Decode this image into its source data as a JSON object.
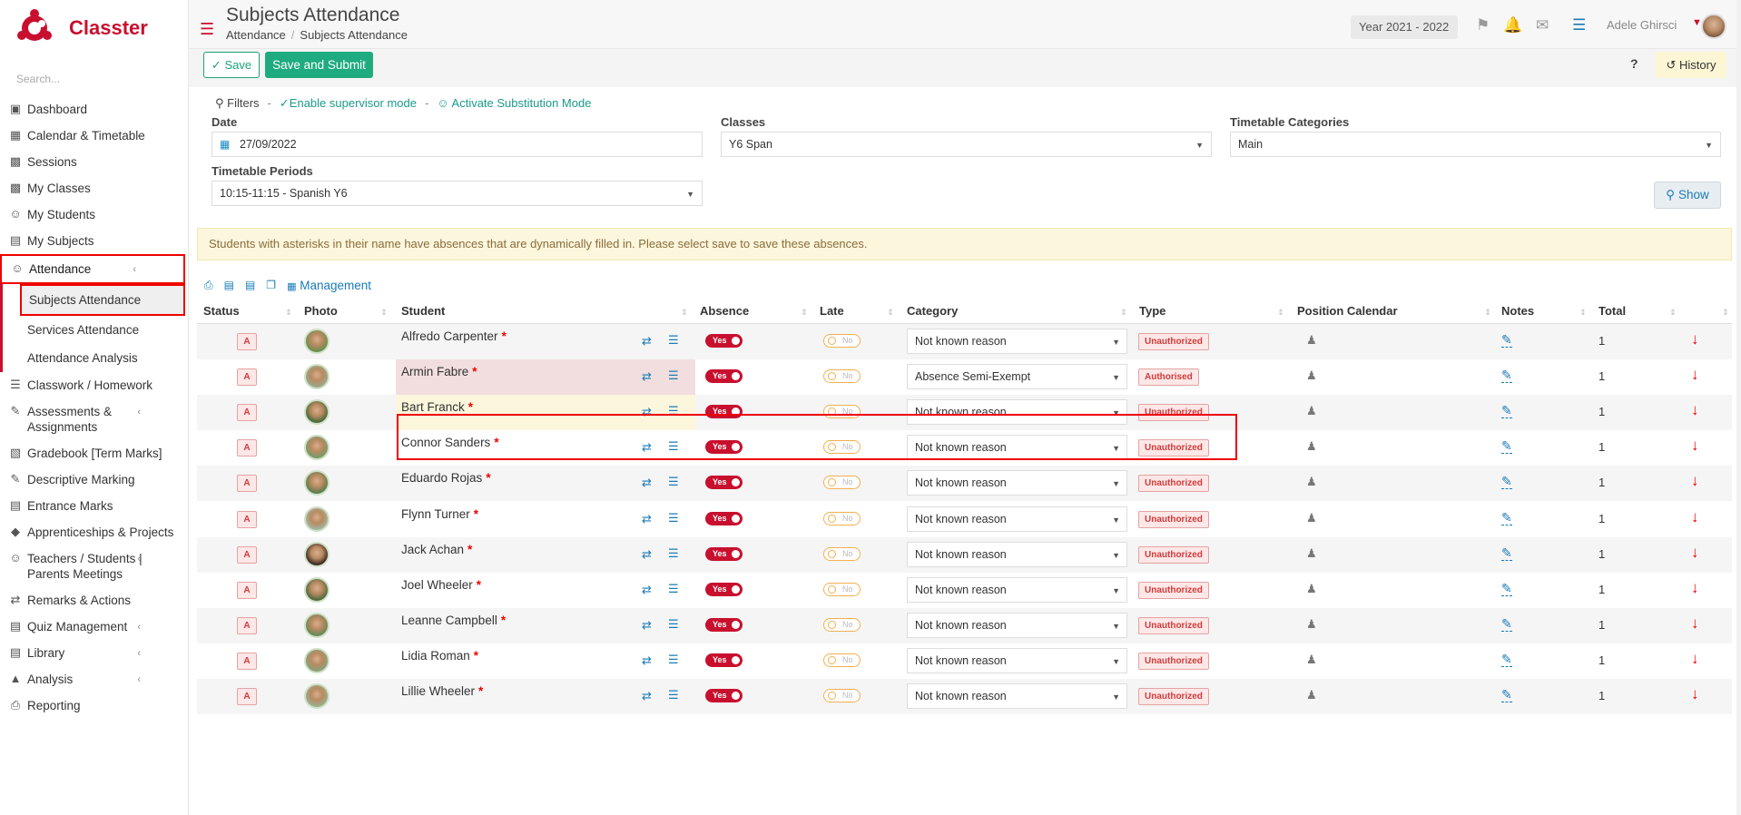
{
  "app": {
    "name": "Classter",
    "search_placeholder": "Search..."
  },
  "sidebar": {
    "items": [
      {
        "label": "Dashboard",
        "icon": "monitor-icon",
        "chevron": false
      },
      {
        "label": "Calendar & Timetable",
        "icon": "calendar-icon",
        "chevron": true
      },
      {
        "label": "Sessions",
        "icon": "sessions-icon",
        "chevron": false
      },
      {
        "label": "My Classes",
        "icon": "classes-icon",
        "chevron": false
      },
      {
        "label": "My Students",
        "icon": "students-icon",
        "chevron": false
      },
      {
        "label": "My Subjects",
        "icon": "book-icon",
        "chevron": false
      },
      {
        "label": "Attendance",
        "icon": "attendance-icon",
        "chevron": true,
        "active": true
      },
      {
        "label": "Classwork / Homework",
        "icon": "list-icon",
        "chevron": false
      },
      {
        "label": "Assessments & Assignments",
        "icon": "edit-icon",
        "chevron": true
      },
      {
        "label": "Gradebook [Term Marks]",
        "icon": "gradebook-icon",
        "chevron": false
      },
      {
        "label": "Descriptive Marking",
        "icon": "marking-icon",
        "chevron": false
      },
      {
        "label": "Entrance Marks",
        "icon": "entrance-icon",
        "chevron": false
      },
      {
        "label": "Apprenticeships & Projects",
        "icon": "projects-icon",
        "chevron": true
      },
      {
        "label": "Teachers / Students | Parents Meetings",
        "icon": "meetings-icon",
        "chevron": true
      },
      {
        "label": "Remarks & Actions",
        "icon": "remarks-icon",
        "chevron": false
      },
      {
        "label": "Quiz Management",
        "icon": "quiz-icon",
        "chevron": true
      },
      {
        "label": "Library",
        "icon": "library-icon",
        "chevron": true
      },
      {
        "label": "Analysis",
        "icon": "analysis-icon",
        "chevron": true
      },
      {
        "label": "Reporting",
        "icon": "printer-icon",
        "chevron": false
      }
    ],
    "attendance_sub": [
      "Subjects Attendance",
      "Services Attendance",
      "Attendance Analysis"
    ]
  },
  "header": {
    "title": "Subjects Attendance",
    "breadcrumb": [
      "Attendance",
      "Subjects Attendance"
    ],
    "year": "Year 2021 - 2022",
    "user": "Adele Ghirsci"
  },
  "toolbar": {
    "save_label": "Save",
    "submit_label": "Save and Submit",
    "help_label": "?",
    "history_label": "History"
  },
  "filters": {
    "filters_label": "Filters",
    "supervisor_label": "Enable supervisor mode",
    "substitution_label": "Activate Substitution Mode",
    "date_label": "Date",
    "date_value": "27/09/2022",
    "classes_label": "Classes",
    "classes_value": "Y6 Span",
    "categories_label": "Timetable Categories",
    "categories_value": "Main",
    "periods_label": "Timetable Periods",
    "periods_value": "10:15-11:15 - Spanish Y6",
    "show_label": "Show"
  },
  "notice": "Students with asterisks in their name have absences that are dynamically filled in. Please select save to save these absences.",
  "management_label": "Management",
  "table": {
    "columns": [
      "Status",
      "Photo",
      "Student",
      "Absence",
      "Late",
      "Category",
      "Type",
      "Position Calendar",
      "Notes",
      "Total"
    ],
    "rows": [
      {
        "status": "A",
        "name": "Alfredo Carpenter",
        "absence": "Yes",
        "late": "No",
        "category": "Not known reason",
        "type": "Unauthorized",
        "total": "1"
      },
      {
        "status": "A",
        "name": "Armin Fabre",
        "absence": "Yes",
        "late": "No",
        "category": "Absence Semi-Exempt",
        "type": "Authorised",
        "total": "1"
      },
      {
        "status": "A",
        "name": "Bart Franck",
        "absence": "Yes",
        "late": "No",
        "category": "Not known reason",
        "type": "Unauthorized",
        "total": "1"
      },
      {
        "status": "A",
        "name": "Connor Sanders",
        "absence": "Yes",
        "late": "No",
        "category": "Not known reason",
        "type": "Unauthorized",
        "total": "1"
      },
      {
        "status": "A",
        "name": "Eduardo Rojas",
        "absence": "Yes",
        "late": "No",
        "category": "Not known reason",
        "type": "Unauthorized",
        "total": "1"
      },
      {
        "status": "A",
        "name": "Flynn Turner",
        "absence": "Yes",
        "late": "No",
        "category": "Not known reason",
        "type": "Unauthorized",
        "total": "1"
      },
      {
        "status": "A",
        "name": "Jack Achan",
        "absence": "Yes",
        "late": "No",
        "category": "Not known reason",
        "type": "Unauthorized",
        "total": "1"
      },
      {
        "status": "A",
        "name": "Joel Wheeler",
        "absence": "Yes",
        "late": "No",
        "category": "Not known reason",
        "type": "Unauthorized",
        "total": "1"
      },
      {
        "status": "A",
        "name": "Leanne Campbell",
        "absence": "Yes",
        "late": "No",
        "category": "Not known reason",
        "type": "Unauthorized",
        "total": "1"
      },
      {
        "status": "A",
        "name": "Lidia Roman",
        "absence": "Yes",
        "late": "No",
        "category": "Not known reason",
        "type": "Unauthorized",
        "total": "1"
      },
      {
        "status": "A",
        "name": "Lillie Wheeler",
        "absence": "Yes",
        "late": "No",
        "category": "Not known reason",
        "type": "Unauthorized",
        "total": "1"
      }
    ]
  },
  "colors": {
    "brand": "#c8102e",
    "accent": "#1eab7f",
    "link": "#1a7bb8"
  }
}
